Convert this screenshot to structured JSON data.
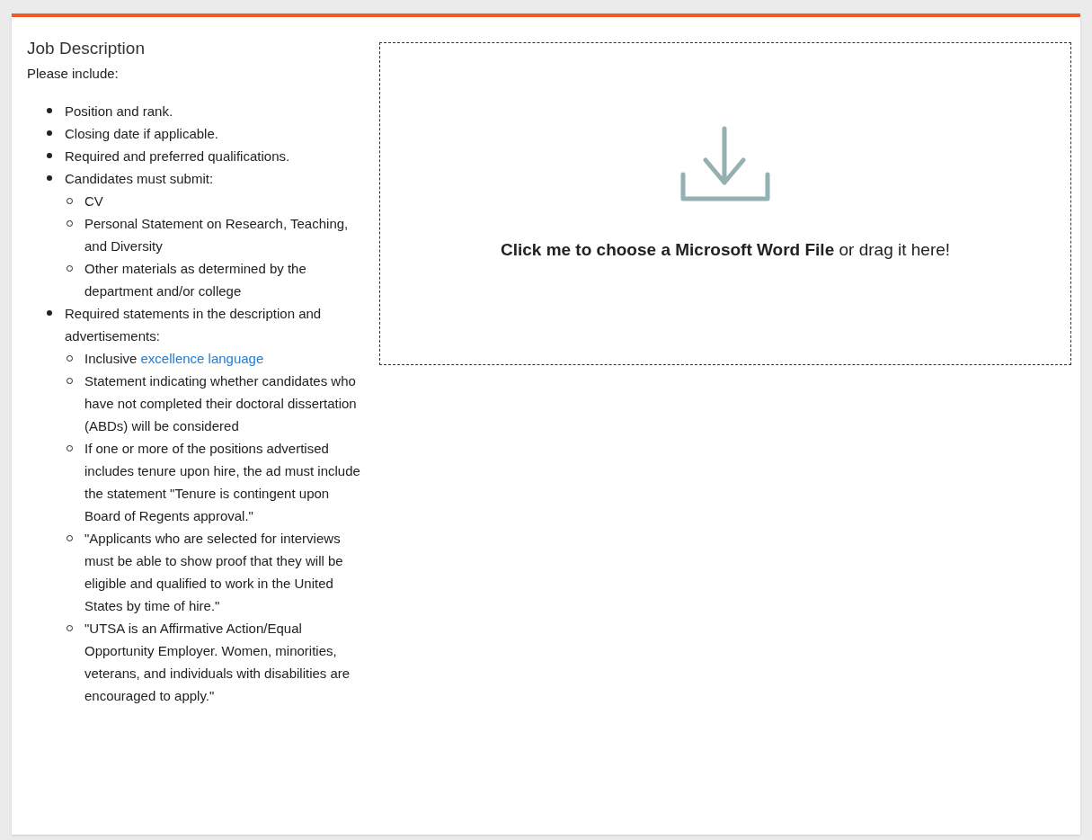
{
  "section": {
    "title": "Job Description",
    "intro": "Please include:"
  },
  "items": [
    {
      "text": "Position and rank."
    },
    {
      "text": "Closing date if applicable."
    },
    {
      "text": "Required and preferred qualifications."
    },
    {
      "text": "Candidates must submit:",
      "children": [
        {
          "text": "CV"
        },
        {
          "text": "Personal Statement on Research, Teaching, and Diversity"
        },
        {
          "text": "Other materials as determined by the department and/or college"
        }
      ]
    },
    {
      "text": "Required statements in the description and advertisements:",
      "children": [
        {
          "text": "Inclusive",
          "link": "excellence language"
        },
        {
          "text": "Statement indicating whether candidates who have not completed their doctoral dissertation (ABDs) will be considered"
        },
        {
          "text": "If one or more of the positions advertised includes tenure upon hire, the ad must include the statement \"Tenure is contingent upon Board of Regents approval.\""
        },
        {
          "text": "\"Applicants who are selected for interviews must be able to show proof that they will be eligible and qualified to work in the United States by time of hire.\""
        },
        {
          "text": "\"UTSA is an Affirmative Action/Equal Opportunity Employer. Women, minorities, veterans, and individuals with disabilities are encouraged to apply.\""
        }
      ]
    }
  ],
  "dropzone": {
    "label": "**Click me to choose a Microsoft Word File** or drag it here!"
  }
}
